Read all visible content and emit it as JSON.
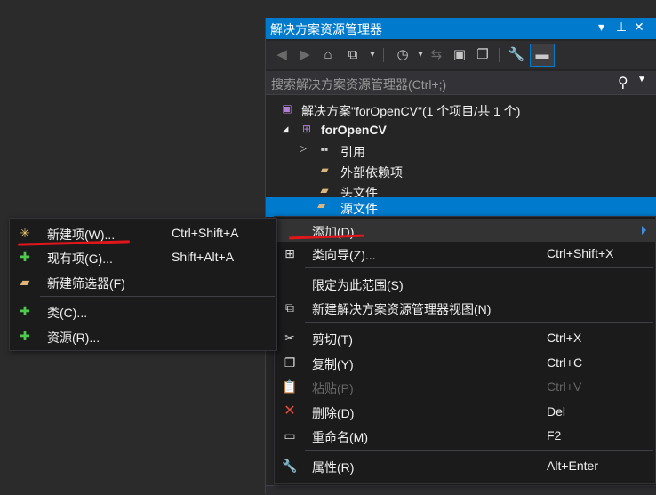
{
  "panel": {
    "title": "解决方案资源管理器",
    "title_buttons": [
      "▾",
      "⊥",
      "✕"
    ],
    "search_placeholder": "搜索解决方案资源管理器(Ctrl+;)"
  },
  "tree": {
    "solution": "解决方案\"forOpenCV\"(1 个项目/共 1 个)",
    "project": "forOpenCV",
    "items": [
      "引用",
      "外部依赖项",
      "头文件",
      "源文件"
    ]
  },
  "menu": {
    "items": [
      {
        "label": "添加(D)",
        "shortcut": "",
        "icon": "none",
        "disabled": false
      },
      {
        "label": "类向导(Z)...",
        "shortcut": "Ctrl+Shift+X",
        "icon": "class-wizard-icon",
        "disabled": false
      },
      {
        "label": "限定为此范围(S)",
        "shortcut": "",
        "icon": "none",
        "disabled": false
      },
      {
        "label": "新建解决方案资源管理器视图(N)",
        "shortcut": "",
        "icon": "new-view-icon",
        "disabled": false
      },
      {
        "label": "剪切(T)",
        "shortcut": "Ctrl+X",
        "icon": "scissors-icon",
        "disabled": false
      },
      {
        "label": "复制(Y)",
        "shortcut": "Ctrl+C",
        "icon": "copy-icon",
        "disabled": false
      },
      {
        "label": "粘贴(P)",
        "shortcut": "Ctrl+V",
        "icon": "paste-icon",
        "disabled": true
      },
      {
        "label": "删除(D)",
        "shortcut": "Del",
        "icon": "delete-icon",
        "disabled": false
      },
      {
        "label": "重命名(M)",
        "shortcut": "F2",
        "icon": "rename-icon",
        "disabled": false
      },
      {
        "label": "属性(R)",
        "shortcut": "Alt+Enter",
        "icon": "wrench-icon",
        "disabled": false
      }
    ]
  },
  "submenu": {
    "items": [
      {
        "label": "新建项(W)...",
        "shortcut": "Ctrl+Shift+A",
        "icon": "new-item-icon"
      },
      {
        "label": "现有项(G)...",
        "shortcut": "Shift+Alt+A",
        "icon": "existing-item-icon"
      },
      {
        "label": "新建筛选器(F)",
        "shortcut": "",
        "icon": "new-filter-icon"
      },
      {
        "label": "类(C)...",
        "shortcut": "",
        "icon": "add-class-icon"
      },
      {
        "label": "资源(R)...",
        "shortcut": "",
        "icon": "add-resource-icon"
      }
    ]
  },
  "colors": {
    "accent": "#007acc",
    "annotation_red": "#e0161b"
  }
}
